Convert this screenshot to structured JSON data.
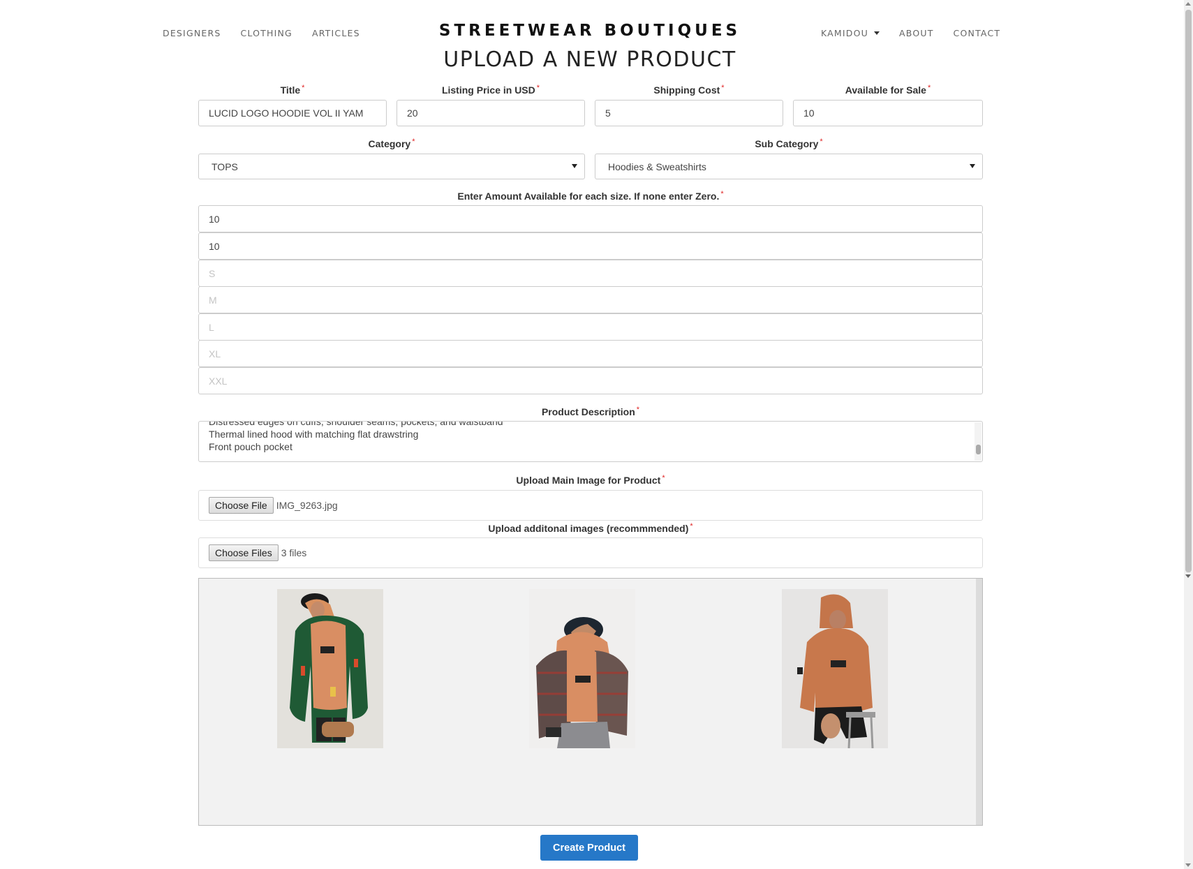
{
  "nav": {
    "left": [
      "DESIGNERS",
      "CLOTHING",
      "ARTICLES"
    ],
    "user": "KAMIDOU",
    "right": [
      "ABOUT",
      "CONTACT"
    ]
  },
  "brand": "STREETWEAR BOUTIQUES",
  "page_title": "UPLOAD A NEW PRODUCT",
  "required_mark": "*",
  "form": {
    "title": {
      "label": "Title",
      "value": "LUCID LOGO HOODIE VOL II YAM"
    },
    "price": {
      "label": "Listing Price in USD",
      "value": "20"
    },
    "shipping": {
      "label": "Shipping Cost",
      "value": "5"
    },
    "available": {
      "label": "Available for Sale",
      "value": "10"
    },
    "category": {
      "label": "Category",
      "value": "TOPS"
    },
    "sub_category": {
      "label": "Sub Category",
      "value": "Hoodies & Sweatshirts"
    },
    "sizes_label": "Enter Amount Available for each size. If none enter Zero.",
    "sizes": [
      {
        "value": "10",
        "placeholder": ""
      },
      {
        "value": "10",
        "placeholder": ""
      },
      {
        "value": "",
        "placeholder": "S"
      },
      {
        "value": "",
        "placeholder": "M"
      },
      {
        "value": "",
        "placeholder": "L"
      },
      {
        "value": "",
        "placeholder": "XL"
      },
      {
        "value": "",
        "placeholder": "XXL"
      }
    ],
    "description": {
      "label": "Product Description",
      "lines": [
        "Distressed edges on cuffs, shoulder seams, pockets, and waistband",
        "Thermal lined hood with matching flat drawstring",
        "Front pouch pocket"
      ]
    },
    "main_image": {
      "label": "Upload Main Image for Product",
      "button": "Choose File",
      "file": "IMG_9263.jpg"
    },
    "additional_images": {
      "label": "Upload additonal images (recommmended)",
      "button": "Choose Files",
      "file": "3 files"
    },
    "submit": "Create Product"
  },
  "colors": {
    "accent": "#2678c8",
    "required": "#e02424",
    "hoodie": "#d98e63"
  }
}
